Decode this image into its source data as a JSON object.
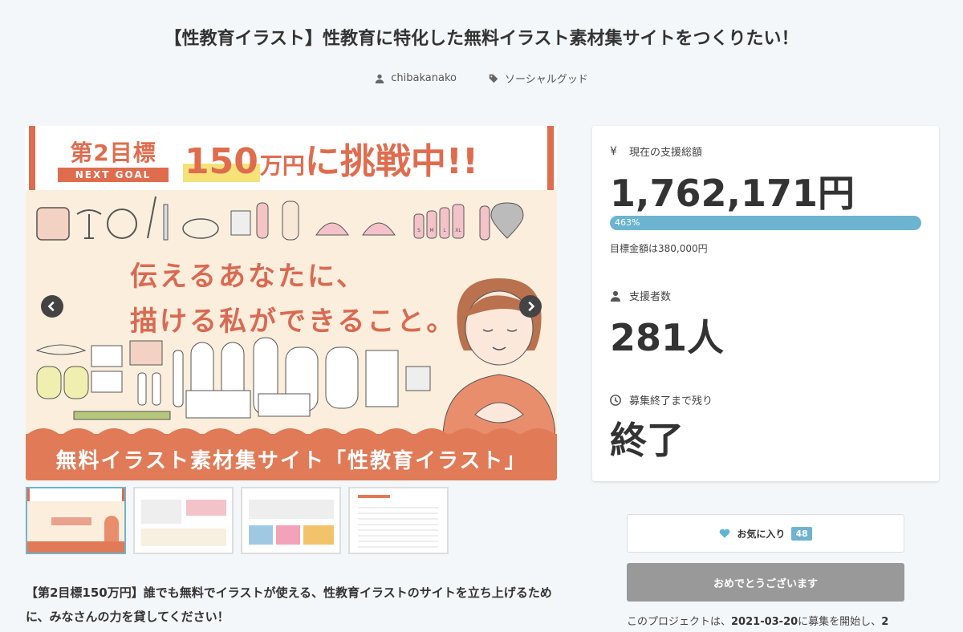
{
  "title": "【性教育イラスト】性教育に特化した無料イラスト素材集サイトをつくりたい！",
  "meta": {
    "author": "chibakanako",
    "category": "ソーシャルグッド"
  },
  "hero": {
    "goal_label": "第2目標",
    "goal_sub": "NEXT GOAL",
    "challenge_num": "150",
    "challenge_unit": "万円",
    "challenge_rest": "に挑戦中!!",
    "catch_line1": "伝えるあなたに、",
    "catch_line2": "描ける私ができること。",
    "bottom": "無料イラスト素材集サイト「性教育イラスト」",
    "size_labels": [
      "S",
      "M",
      "L",
      "XL"
    ]
  },
  "stats": {
    "total_label": "現在の支援総額",
    "total_value": "1,762,171円",
    "percent": "463%",
    "goal_text": "目標金額は380,000円",
    "supporters_label": "支援者数",
    "supporters_value": "281人",
    "remaining_label": "募集終了まで残り",
    "remaining_value": "終了"
  },
  "favorite": {
    "label": "お気に入り",
    "count": "48"
  },
  "congrats_label": "おめでとうございます",
  "period": {
    "prefix": "このプロジェクトは、",
    "date": "2021-03-20",
    "suffix": "に募集を開始し、",
    "cut": "2"
  },
  "description": "【第2目標150万円】誰でも無料でイラストが使える、性教育イラストのサイトを立ち上げるために、みなさんの力を貸してください！"
}
